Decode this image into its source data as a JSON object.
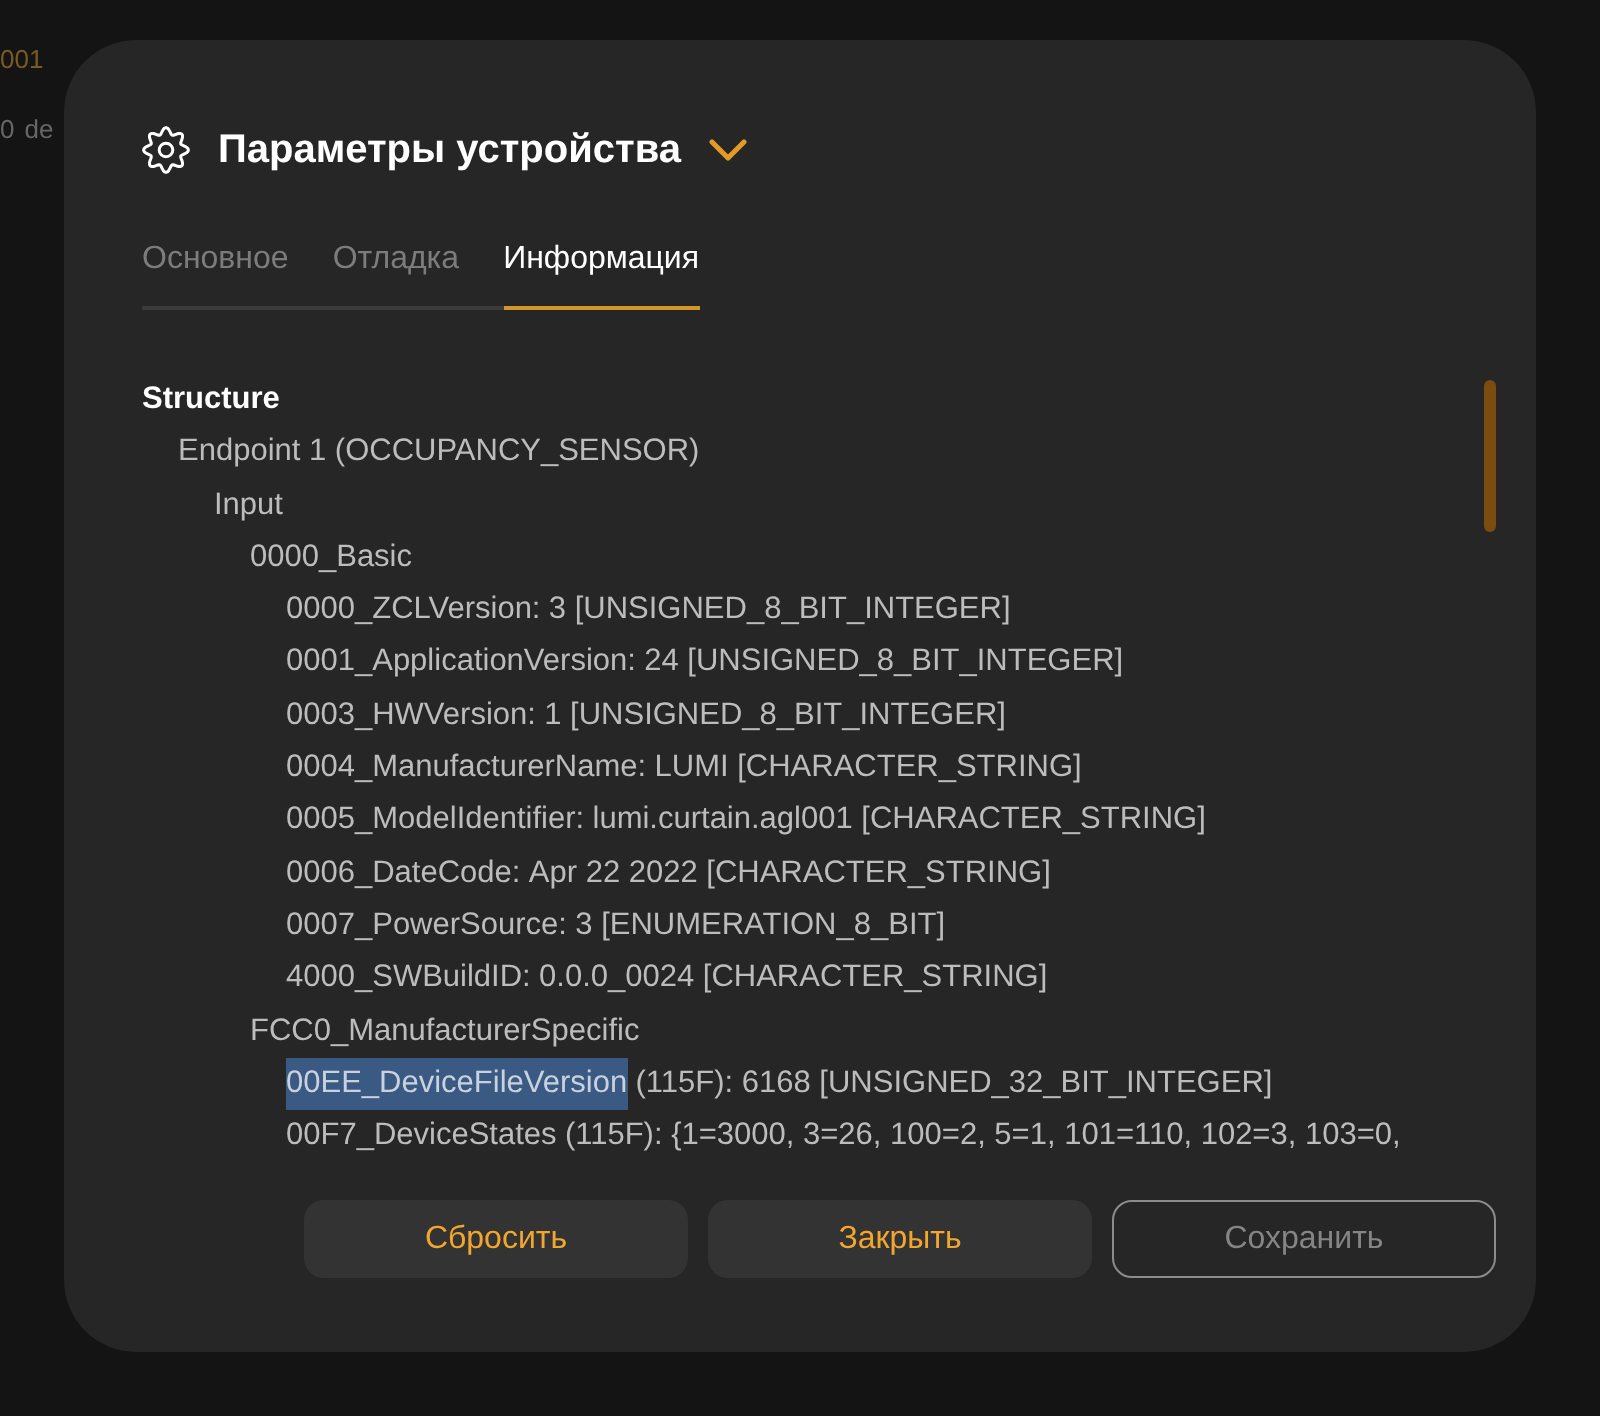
{
  "background_texts": [
    {
      "text": "001",
      "kind": "accent"
    },
    {
      "text": "0",
      "kind": "plain"
    },
    {
      "text": "de",
      "kind": "plain"
    }
  ],
  "dialog": {
    "title": "Параметры устройства",
    "tabs": [
      {
        "label": "Основное",
        "selected": false
      },
      {
        "label": "Отладка",
        "selected": false
      },
      {
        "label": "Информация",
        "selected": true
      }
    ],
    "tree": {
      "heading": "Structure",
      "children": [
        {
          "kind": "group",
          "text": "Endpoint 1 (OCCUPANCY_SENSOR)",
          "children": [
            {
              "kind": "group",
              "text": "Input",
              "children": [
                {
                  "kind": "group",
                  "text": "0000_Basic",
                  "children": [
                    {
                      "kind": "attribute",
                      "name": "0000_ZCLVersion:",
                      "value": "3 [UNSIGNED_8_BIT_INTEGER]",
                      "selected": false
                    },
                    {
                      "kind": "attribute",
                      "name": "0001_ApplicationVersion:",
                      "value": "24 [UNSIGNED_8_BIT_INTEGER]",
                      "selected": false
                    },
                    {
                      "kind": "attribute",
                      "name": "0003_HWVersion:",
                      "value": "1 [UNSIGNED_8_BIT_INTEGER]",
                      "selected": false
                    },
                    {
                      "kind": "attribute",
                      "name": "0004_ManufacturerName:",
                      "value": "LUMI [CHARACTER_STRING]",
                      "selected": false
                    },
                    {
                      "kind": "attribute",
                      "name": "0005_ModelIdentifier:",
                      "value": "lumi.curtain.agl001 [CHARACTER_STRING]",
                      "selected": false
                    },
                    {
                      "kind": "attribute",
                      "name": "0006_DateCode:",
                      "value": "Apr 22 2022 [CHARACTER_STRING]",
                      "selected": false
                    },
                    {
                      "kind": "attribute",
                      "name": "0007_PowerSource:",
                      "value": "3 [ENUMERATION_8_BIT]",
                      "selected": false
                    },
                    {
                      "kind": "attribute",
                      "name": "4000_SWBuildID:",
                      "value": "0.0.0_0024 [CHARACTER_STRING]",
                      "selected": false
                    }
                  ]
                },
                {
                  "kind": "group",
                  "text": "FCC0_ManufacturerSpecific",
                  "children": [
                    {
                      "kind": "attribute",
                      "name": "00EE_DeviceFileVersion",
                      "value": "(115F): 6168 [UNSIGNED_32_BIT_INTEGER]",
                      "selected": true
                    },
                    {
                      "kind": "attribute",
                      "name": "00F7_DeviceStates",
                      "value": "(115F): {1=3000, 3=26, 100=2, 5=1, 101=110, 102=3, 103=0,",
                      "selected": false
                    }
                  ]
                }
              ]
            }
          ]
        }
      ]
    },
    "buttons": [
      {
        "label": "Сбросить",
        "kind": "filled",
        "disabled": false
      },
      {
        "label": "Закрыть",
        "kind": "filled",
        "disabled": false
      },
      {
        "label": "Сохранить",
        "kind": "outline",
        "disabled": true
      }
    ]
  }
}
